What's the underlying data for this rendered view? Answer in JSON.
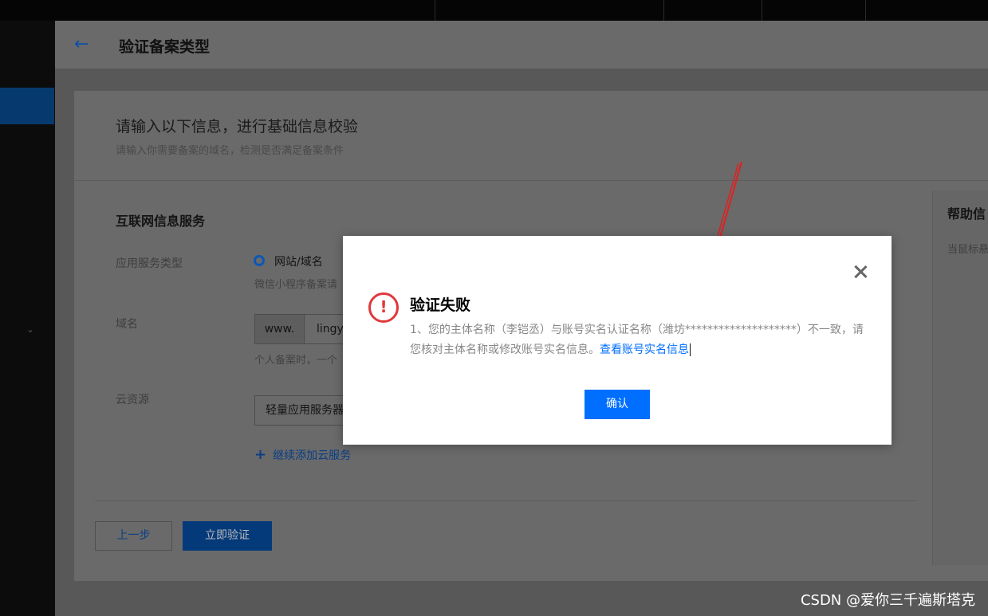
{
  "page": {
    "title": "验证备案类型",
    "intro_title": "请输入以下信息，进行基础信息校验",
    "intro_desc": "请输入你需要备案的域名，检测是否满足备案条件"
  },
  "form": {
    "section_title": "互联网信息服务",
    "service_type_label": "应用服务类型",
    "radio_option": "网站/域名",
    "radio_hint": "微信小程序备案请",
    "domain_label": "域名",
    "domain_prefix": "www.",
    "domain_value": "lingy",
    "domain_hint": "个人备案时，一个",
    "cloud_label": "云资源",
    "cloud_value": "轻量应用服务器",
    "add_cloud": "继续添加云服务",
    "prev_button": "上一步",
    "verify_button": "立即验证"
  },
  "help": {
    "title": "帮助信",
    "text": "当鼠标悬"
  },
  "modal": {
    "title": "验证失败",
    "message": "1、您的主体名称（李铠丞）与账号实名认证名称（潍坊********************）不一致，请您核对主体名称或修改账号实名信息。",
    "link": "查看账号实名信息",
    "confirm_button": "确认"
  },
  "icons": {
    "back": "arrow-left-icon",
    "close": "close-icon",
    "error": "exclamation-circle-icon",
    "add": "plus-icon",
    "chevron": "chevron-down-icon"
  },
  "colors": {
    "primary": "#006eff",
    "error": "#e0383c",
    "annotation": "#e02020"
  },
  "watermark": "CSDN @爱你三千遍斯塔克"
}
